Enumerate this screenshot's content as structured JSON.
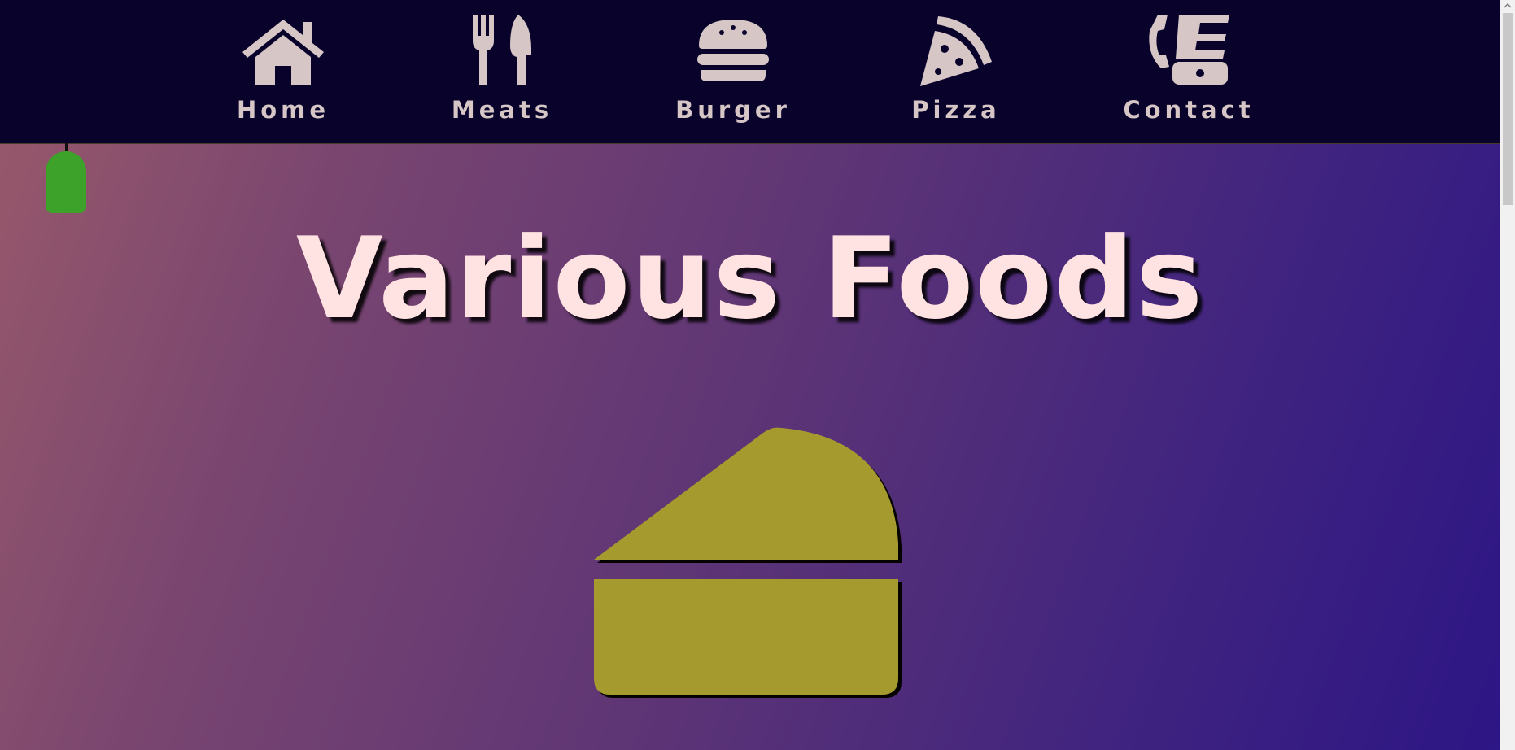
{
  "nav": {
    "items": [
      {
        "label": "Home",
        "icon": "home-icon"
      },
      {
        "label": "Meats",
        "icon": "fork-knife-icon"
      },
      {
        "label": "Burger",
        "icon": "burger-icon"
      },
      {
        "label": "Pizza",
        "icon": "pizza-icon"
      },
      {
        "label": "Contact",
        "icon": "phone-icon"
      }
    ]
  },
  "hero": {
    "title": "Various Foods"
  },
  "colors": {
    "nav_bg": "#09032c",
    "nav_text": "#d6c6c6",
    "title": "#ffe2e2",
    "cake": "#a59a2e",
    "lamp": "#3ca22a"
  }
}
